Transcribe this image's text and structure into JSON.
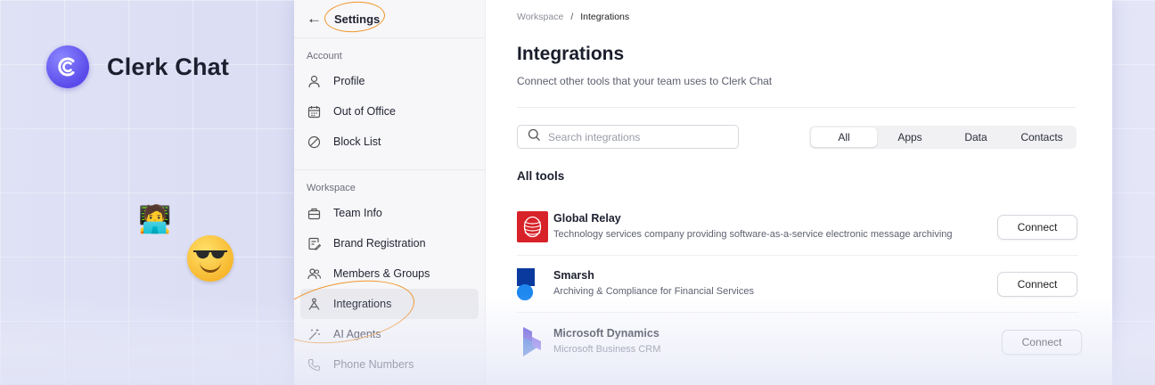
{
  "brand": {
    "name": "Clerk Chat"
  },
  "sidebar": {
    "title": "Settings",
    "account_label": "Account",
    "account_items": [
      {
        "label": "Profile",
        "icon": "user-icon"
      },
      {
        "label": "Out of Office",
        "icon": "calendar-icon"
      },
      {
        "label": "Block List",
        "icon": "block-icon"
      }
    ],
    "workspace_label": "Workspace",
    "workspace_items": [
      {
        "label": "Team Info",
        "icon": "briefcase-icon"
      },
      {
        "label": "Brand Registration",
        "icon": "document-edit-icon"
      },
      {
        "label": "Members & Groups",
        "icon": "users-icon"
      },
      {
        "label": "Integrations",
        "icon": "integrations-icon",
        "active": true
      },
      {
        "label": "AI Agents",
        "icon": "magic-wand-icon"
      },
      {
        "label": "Phone Numbers",
        "icon": "phone-icon"
      }
    ]
  },
  "breadcrumb": {
    "parent": "Workspace",
    "separator": "/",
    "current": "Integrations"
  },
  "page": {
    "title": "Integrations",
    "subtitle": "Connect other tools that your team uses to Clerk Chat"
  },
  "search": {
    "placeholder": "Search integrations"
  },
  "filters": [
    {
      "label": "All",
      "active": true
    },
    {
      "label": "Apps"
    },
    {
      "label": "Data"
    },
    {
      "label": "Contacts"
    }
  ],
  "section_title": "All tools",
  "integrations": [
    {
      "name": "Global Relay",
      "description": "Technology services company providing software-as-a-service electronic message archiving",
      "button": "Connect"
    },
    {
      "name": "Smarsh",
      "description": "Archiving & Compliance for Financial Services",
      "button": "Connect"
    },
    {
      "name": "Microsoft Dynamics",
      "description": "Microsoft Business CRM",
      "button": "Connect"
    }
  ],
  "colors": {
    "accent": "#5a4bea",
    "annotation": "#f0952a",
    "global_relay": "#d8222a",
    "smarsh": "#1c6fe6"
  }
}
